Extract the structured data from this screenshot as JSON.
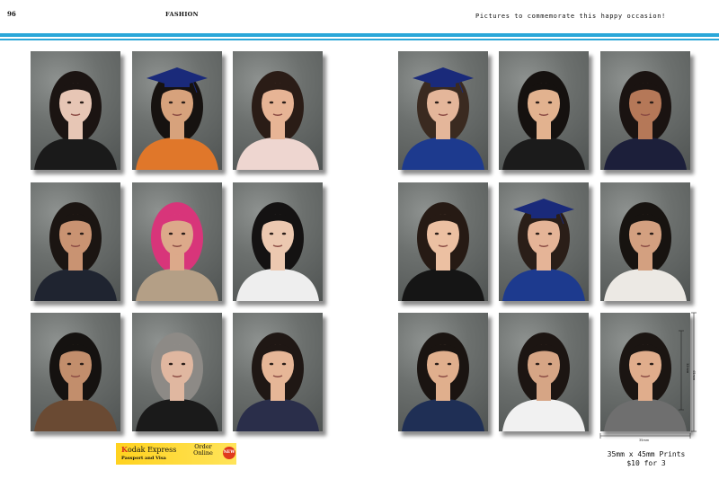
{
  "header": {
    "page_number": "96",
    "section": "FASHION",
    "tagline": "Pictures to commemorate this happy occasion!"
  },
  "colors": {
    "band": "#2aa7d9",
    "ad_yellow": "#ffd21f",
    "new_badge": "#e03a1e"
  },
  "portraits": [
    {
      "id": "woman-black-hair",
      "hair": "#1b1412",
      "skin": "#e7c6b5",
      "clothes": "#1a1a1a",
      "cap": false
    },
    {
      "id": "graduate-man-orange-stole",
      "hair": "#161210",
      "skin": "#d7a27c",
      "clothes": "#e0772a",
      "cap": true
    },
    {
      "id": "girl-long-hair",
      "hair": "#2a1c16",
      "skin": "#e7b495",
      "clothes": "#eed6d0",
      "cap": false
    },
    {
      "id": "graduate-woman",
      "hair": "#3a2a20",
      "skin": "#e4b69a",
      "clothes": "#1d3a8e",
      "cap": true
    },
    {
      "id": "boy-school-uniform",
      "hair": "#15110f",
      "skin": "#e2b28f",
      "clothes": "#1b1b1b",
      "cap": false
    },
    {
      "id": "woman-lace-top",
      "hair": "#1a1311",
      "skin": "#b57858",
      "clothes": "#1c1f3a",
      "cap": false
    },
    {
      "id": "young-man-sweater-vest",
      "hair": "#1b1512",
      "skin": "#c99372",
      "clothes": "#1f2430",
      "cap": false
    },
    {
      "id": "woman-pink-hair",
      "hair": "#d8357a",
      "skin": "#dca98a",
      "clothes": "#b49f86",
      "cap": false
    },
    {
      "id": "woman-bob-white-top",
      "hair": "#141212",
      "skin": "#ecc8b0",
      "clothes": "#eeeeee",
      "cap": false
    },
    {
      "id": "child-black-shirt",
      "hair": "#261a14",
      "skin": "#ecc0a2",
      "clothes": "#151515",
      "cap": false
    },
    {
      "id": "graduate-girl",
      "hair": "#2a1e18",
      "skin": "#e5b497",
      "clothes": "#1d3a8e",
      "cap": true
    },
    {
      "id": "man-hair-bun",
      "hair": "#171310",
      "skin": "#d3a080",
      "clothes": "#ece9e4",
      "cap": false
    },
    {
      "id": "woman-short-hair",
      "hair": "#151210",
      "skin": "#c28e6c",
      "clothes": "#6a4a33",
      "cap": false
    },
    {
      "id": "man-gray-hair",
      "hair": "#8d8a86",
      "skin": "#e0b7a0",
      "clothes": "#1a1a1a",
      "cap": false
    },
    {
      "id": "teen-girl-navy-top",
      "hair": "#1f1714",
      "skin": "#e6b697",
      "clothes": "#2a2e4a",
      "cap": false
    },
    {
      "id": "young-man-blue-shirt",
      "hair": "#1a1411",
      "skin": "#e0af8d",
      "clothes": "#1f2f55",
      "cap": false
    },
    {
      "id": "woman-white-collar",
      "hair": "#1c1512",
      "skin": "#d6a585",
      "clothes": "#f1f1f1",
      "cap": false
    },
    {
      "id": "woman-gray-top-measured",
      "hair": "#1b1512",
      "skin": "#e0ad8c",
      "clothes": "#6f6f6f",
      "cap": false
    }
  ],
  "ad": {
    "brand_letter": "K",
    "brand_rest": "odak",
    "brand_word": "Express",
    "subtitle": "Passport and Visa",
    "order_line1": "Order",
    "order_line2": "Online",
    "badge": "NEW"
  },
  "print_info": {
    "line1": "35mm x 45mm Prints",
    "line2": "$10 for 3",
    "width_label": "35mm",
    "height_label": "45mm",
    "face_label": "32mm"
  }
}
